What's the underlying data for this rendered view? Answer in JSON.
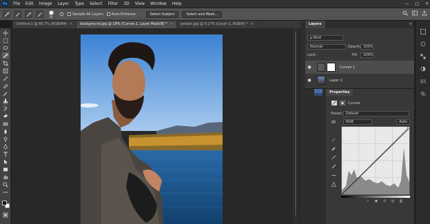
{
  "app": {
    "logo": "Ps"
  },
  "menu": [
    "File",
    "Edit",
    "Image",
    "Layer",
    "Type",
    "Select",
    "Filter",
    "3D",
    "View",
    "Window",
    "Help"
  ],
  "window_controls": {
    "minimize": "—",
    "maximize": "□",
    "close": "✕"
  },
  "options": {
    "brush_size": "10",
    "sample_all_layers": "Sample All Layers",
    "auto_enhance": "Auto-Enhance",
    "select_subject": "Select Subject",
    "select_and_mask": "Select and Mask..."
  },
  "tabs": [
    {
      "label": "Untitled-1 @ 66.7% (RGB/8#)",
      "close": "×"
    },
    {
      "label": "background.jpg @ 18% (Curves 1, Layer Mask/8) *",
      "close": "×"
    },
    {
      "label": "people.jpg @ 9.17% (Layer 1, RGB/8) *",
      "close": "×"
    }
  ],
  "layers_panel": {
    "title": "Layers",
    "filter": "ρ Kind",
    "blend_mode": "Normal",
    "opacity_label": "Opacity:",
    "opacity_value": "100%",
    "lock_label": "Lock:",
    "fill_label": "Fill:",
    "fill_value": "100%",
    "layers": [
      {
        "name": "Curves 1",
        "selected": true
      },
      {
        "name": "Layer 1",
        "selected": false
      }
    ]
  },
  "properties_panel": {
    "title": "Properties",
    "adjustment": "Curves",
    "preset_label": "Preset:",
    "preset_value": "Default",
    "channel": "RGB",
    "auto_label": "Auto"
  },
  "colors": {
    "accent": "#31a8ff",
    "sky": "#7fb2e6",
    "water": "#1d5d9e"
  }
}
